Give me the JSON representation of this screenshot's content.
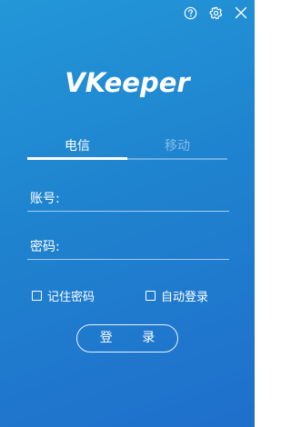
{
  "app": {
    "logo_text": "VKeeper"
  },
  "topbar": {
    "help_icon": "help-circle-icon",
    "settings_icon": "gear-icon",
    "close_icon": "close-icon"
  },
  "tabs": [
    {
      "label": "电信",
      "active": true
    },
    {
      "label": "移动",
      "active": false
    }
  ],
  "form": {
    "account_label": "账号:",
    "account_value": "",
    "password_label": "密码:",
    "password_value": ""
  },
  "options": {
    "remember_password": {
      "label": "记住密码",
      "checked": false
    },
    "auto_login": {
      "label": "自动登录",
      "checked": false
    }
  },
  "login_button": {
    "label": "登 录"
  },
  "colors": {
    "background_start": "#2397d8",
    "background_end": "#1f6fcb",
    "text": "#ffffff"
  }
}
